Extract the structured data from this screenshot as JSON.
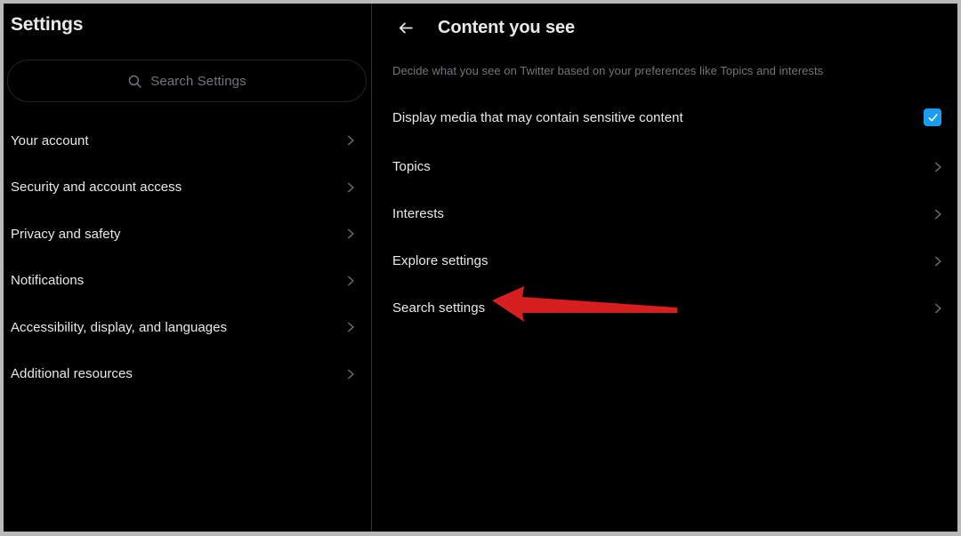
{
  "window": {
    "border_color": "#b9b9b9",
    "background": "#000000"
  },
  "sidebar": {
    "title": "Settings",
    "search": {
      "placeholder": "Search Settings",
      "icon": "search-icon",
      "value": ""
    },
    "items": [
      {
        "label": "Your account",
        "chevron": "chevron-right-icon"
      },
      {
        "label": "Security and account access",
        "chevron": "chevron-right-icon"
      },
      {
        "label": "Privacy and safety",
        "chevron": "chevron-right-icon"
      },
      {
        "label": "Notifications",
        "chevron": "chevron-right-icon"
      },
      {
        "label": "Accessibility, display, and languages",
        "chevron": "chevron-right-icon"
      },
      {
        "label": "Additional resources",
        "chevron": "chevron-right-icon"
      }
    ]
  },
  "main": {
    "back_icon": "back-arrow-icon",
    "title": "Content you see",
    "description": "Decide what you see on Twitter based on your preferences like Topics and interests",
    "sensitive_media": {
      "label": "Display media that may contain sensitive content",
      "checked": true,
      "accent_color": "#1d9bf0",
      "check_icon": "checkmark-icon"
    },
    "items": [
      {
        "label": "Topics",
        "chevron": "chevron-right-icon"
      },
      {
        "label": "Interests",
        "chevron": "chevron-right-icon"
      },
      {
        "label": "Explore settings",
        "chevron": "chevron-right-icon"
      },
      {
        "label": "Search settings",
        "chevron": "chevron-right-icon"
      }
    ]
  },
  "annotation": {
    "type": "arrow",
    "color": "#d61f1f",
    "points_to": "Search settings",
    "direction": "left"
  }
}
